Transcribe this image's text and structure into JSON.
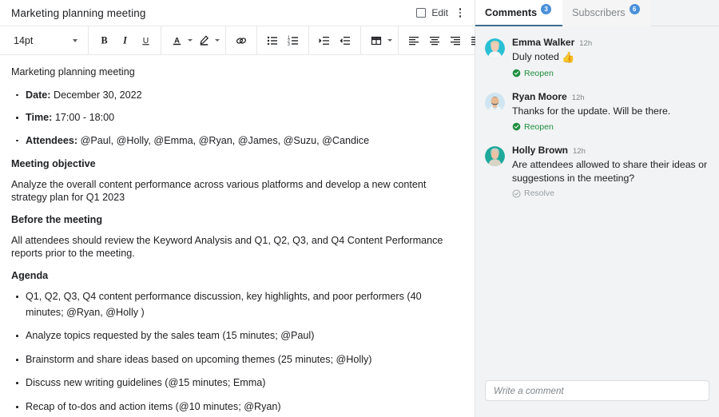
{
  "header": {
    "title": "Marketing planning meeting",
    "edit_label": "Edit",
    "menu_icon": "kebab-menu-icon"
  },
  "toolbar": {
    "font_size": "14pt",
    "buttons": [
      {
        "name": "bold",
        "label": "B"
      },
      {
        "name": "italic",
        "label": "I"
      },
      {
        "name": "underline",
        "label": "U"
      },
      {
        "name": "text-color",
        "label": "A"
      },
      {
        "name": "highlight-color",
        "label": ""
      },
      {
        "name": "insert-link",
        "label": ""
      },
      {
        "name": "bulleted-list",
        "label": ""
      },
      {
        "name": "numbered-list",
        "label": ""
      },
      {
        "name": "increase-indent",
        "label": ""
      },
      {
        "name": "decrease-indent",
        "label": ""
      },
      {
        "name": "insert-table",
        "label": ""
      },
      {
        "name": "align-left",
        "label": ""
      },
      {
        "name": "align-center",
        "label": ""
      },
      {
        "name": "align-right",
        "label": ""
      },
      {
        "name": "align-justify",
        "label": ""
      },
      {
        "name": "print",
        "label": ""
      }
    ]
  },
  "document": {
    "title": "Marketing planning meeting",
    "meta": [
      {
        "label": "Date:",
        "value": "December 30, 2022"
      },
      {
        "label": "Time:",
        "value": "17:00 - 18:00"
      },
      {
        "label": "Attendees:",
        "value": "@Paul, @Holly, @Emma, @Ryan, @James, @Suzu, @Candice"
      }
    ],
    "objective_heading": "Meeting objective",
    "objective_text": "Analyze the overall content performance across various platforms and develop a new content strategy plan for Q1 2023",
    "before_heading": "Before the meeting",
    "before_text": "All attendees should review the Keyword Analysis and Q1, Q2, Q3, and Q4 Content Performance reports prior to the meeting.",
    "agenda_heading": "Agenda",
    "agenda_items": [
      "Q1, Q2, Q3, Q4 content performance discussion, key highlights, and poor performers (40 minutes; @Ryan, @Holly )",
      "Analyze topics requested by the sales team (15 minutes; @Paul)",
      "Brainstorm and share ideas based on upcoming themes (25 minutes; @Holly)",
      "Discuss new writing guidelines (@15 minutes; Emma)",
      "Recap of to-dos and action items (@10 minutes; @Ryan)"
    ]
  },
  "sidebar": {
    "tabs": [
      {
        "label": "Comments",
        "badge": "3",
        "active": true
      },
      {
        "label": "Subscribers",
        "badge": "6",
        "active": false
      }
    ],
    "comments": [
      {
        "author": "Emma Walker",
        "time": "12h",
        "text": "Duly noted ",
        "emoji": "👍",
        "action": "Reopen",
        "action_type": "reopen",
        "avatar_bg": "#2bbfd4",
        "avatar_face": "#f0cdb4",
        "avatar_hair": "#d9c9a8",
        "avatar_body": "#f2f4f5"
      },
      {
        "author": "Ryan Moore",
        "time": "12h",
        "text": "Thanks for the update. Will be there.",
        "emoji": "",
        "action": "Reopen",
        "action_type": "reopen",
        "avatar_bg": "#cfe6f2",
        "avatar_face": "#e8b88f",
        "avatar_hair": "#2f4a63",
        "avatar_body": "#eef2f5"
      },
      {
        "author": "Holly Brown",
        "time": "12h",
        "text": "Are attendees allowed to share their ideas or suggestions in the meeting?",
        "emoji": "",
        "action": "Resolve",
        "action_type": "resolve",
        "avatar_bg": "#1fa99b",
        "avatar_face": "#eac3a6",
        "avatar_hair": "#cfcfc4",
        "avatar_body": "#d8d4c6"
      }
    ],
    "composer_placeholder": "Write a comment"
  },
  "colors": {
    "accent": "#4a90d9",
    "tab_underline": "#3d6e8f",
    "resolved_green": "#1e8e3e",
    "muted": "#80868b",
    "panel_bg": "#f1f3f4"
  }
}
